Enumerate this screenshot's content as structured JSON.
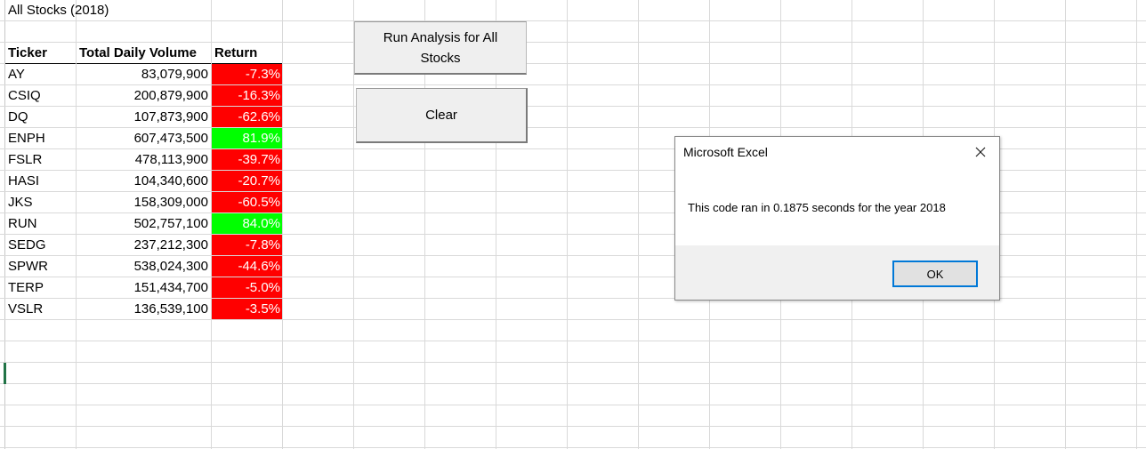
{
  "sheet": {
    "title": "All Stocks (2018)",
    "headers": {
      "ticker": "Ticker",
      "volume": "Total Daily Volume",
      "return": "Return"
    },
    "rows": [
      {
        "ticker": "AY",
        "volume": "83,079,900",
        "return": "-7.3%",
        "status": "negative"
      },
      {
        "ticker": "CSIQ",
        "volume": "200,879,900",
        "return": "-16.3%",
        "status": "negative"
      },
      {
        "ticker": "DQ",
        "volume": "107,873,900",
        "return": "-62.6%",
        "status": "negative"
      },
      {
        "ticker": "ENPH",
        "volume": "607,473,500",
        "return": "81.9%",
        "status": "positive"
      },
      {
        "ticker": "FSLR",
        "volume": "478,113,900",
        "return": "-39.7%",
        "status": "negative"
      },
      {
        "ticker": "HASI",
        "volume": "104,340,600",
        "return": "-20.7%",
        "status": "negative"
      },
      {
        "ticker": "JKS",
        "volume": "158,309,000",
        "return": "-60.5%",
        "status": "negative"
      },
      {
        "ticker": "RUN",
        "volume": "502,757,100",
        "return": "84.0%",
        "status": "positive"
      },
      {
        "ticker": "SEDG",
        "volume": "237,212,300",
        "return": "-7.8%",
        "status": "negative"
      },
      {
        "ticker": "SPWR",
        "volume": "538,024,300",
        "return": "-44.6%",
        "status": "negative"
      },
      {
        "ticker": "TERP",
        "volume": "151,434,700",
        "return": "-5.0%",
        "status": "negative"
      },
      {
        "ticker": "VSLR",
        "volume": "136,539,100",
        "return": "-3.5%",
        "status": "negative"
      }
    ],
    "colors": {
      "negative": "#ff0000",
      "positive": "#00ff00"
    }
  },
  "buttons": {
    "run_line1": "Run Analysis for All",
    "run_line2": "Stocks",
    "clear": "Clear"
  },
  "dialog": {
    "title": "Microsoft Excel",
    "message": "This code ran in 0.1875 seconds for the year 2018",
    "ok": "OK",
    "close_icon": "close-icon"
  }
}
